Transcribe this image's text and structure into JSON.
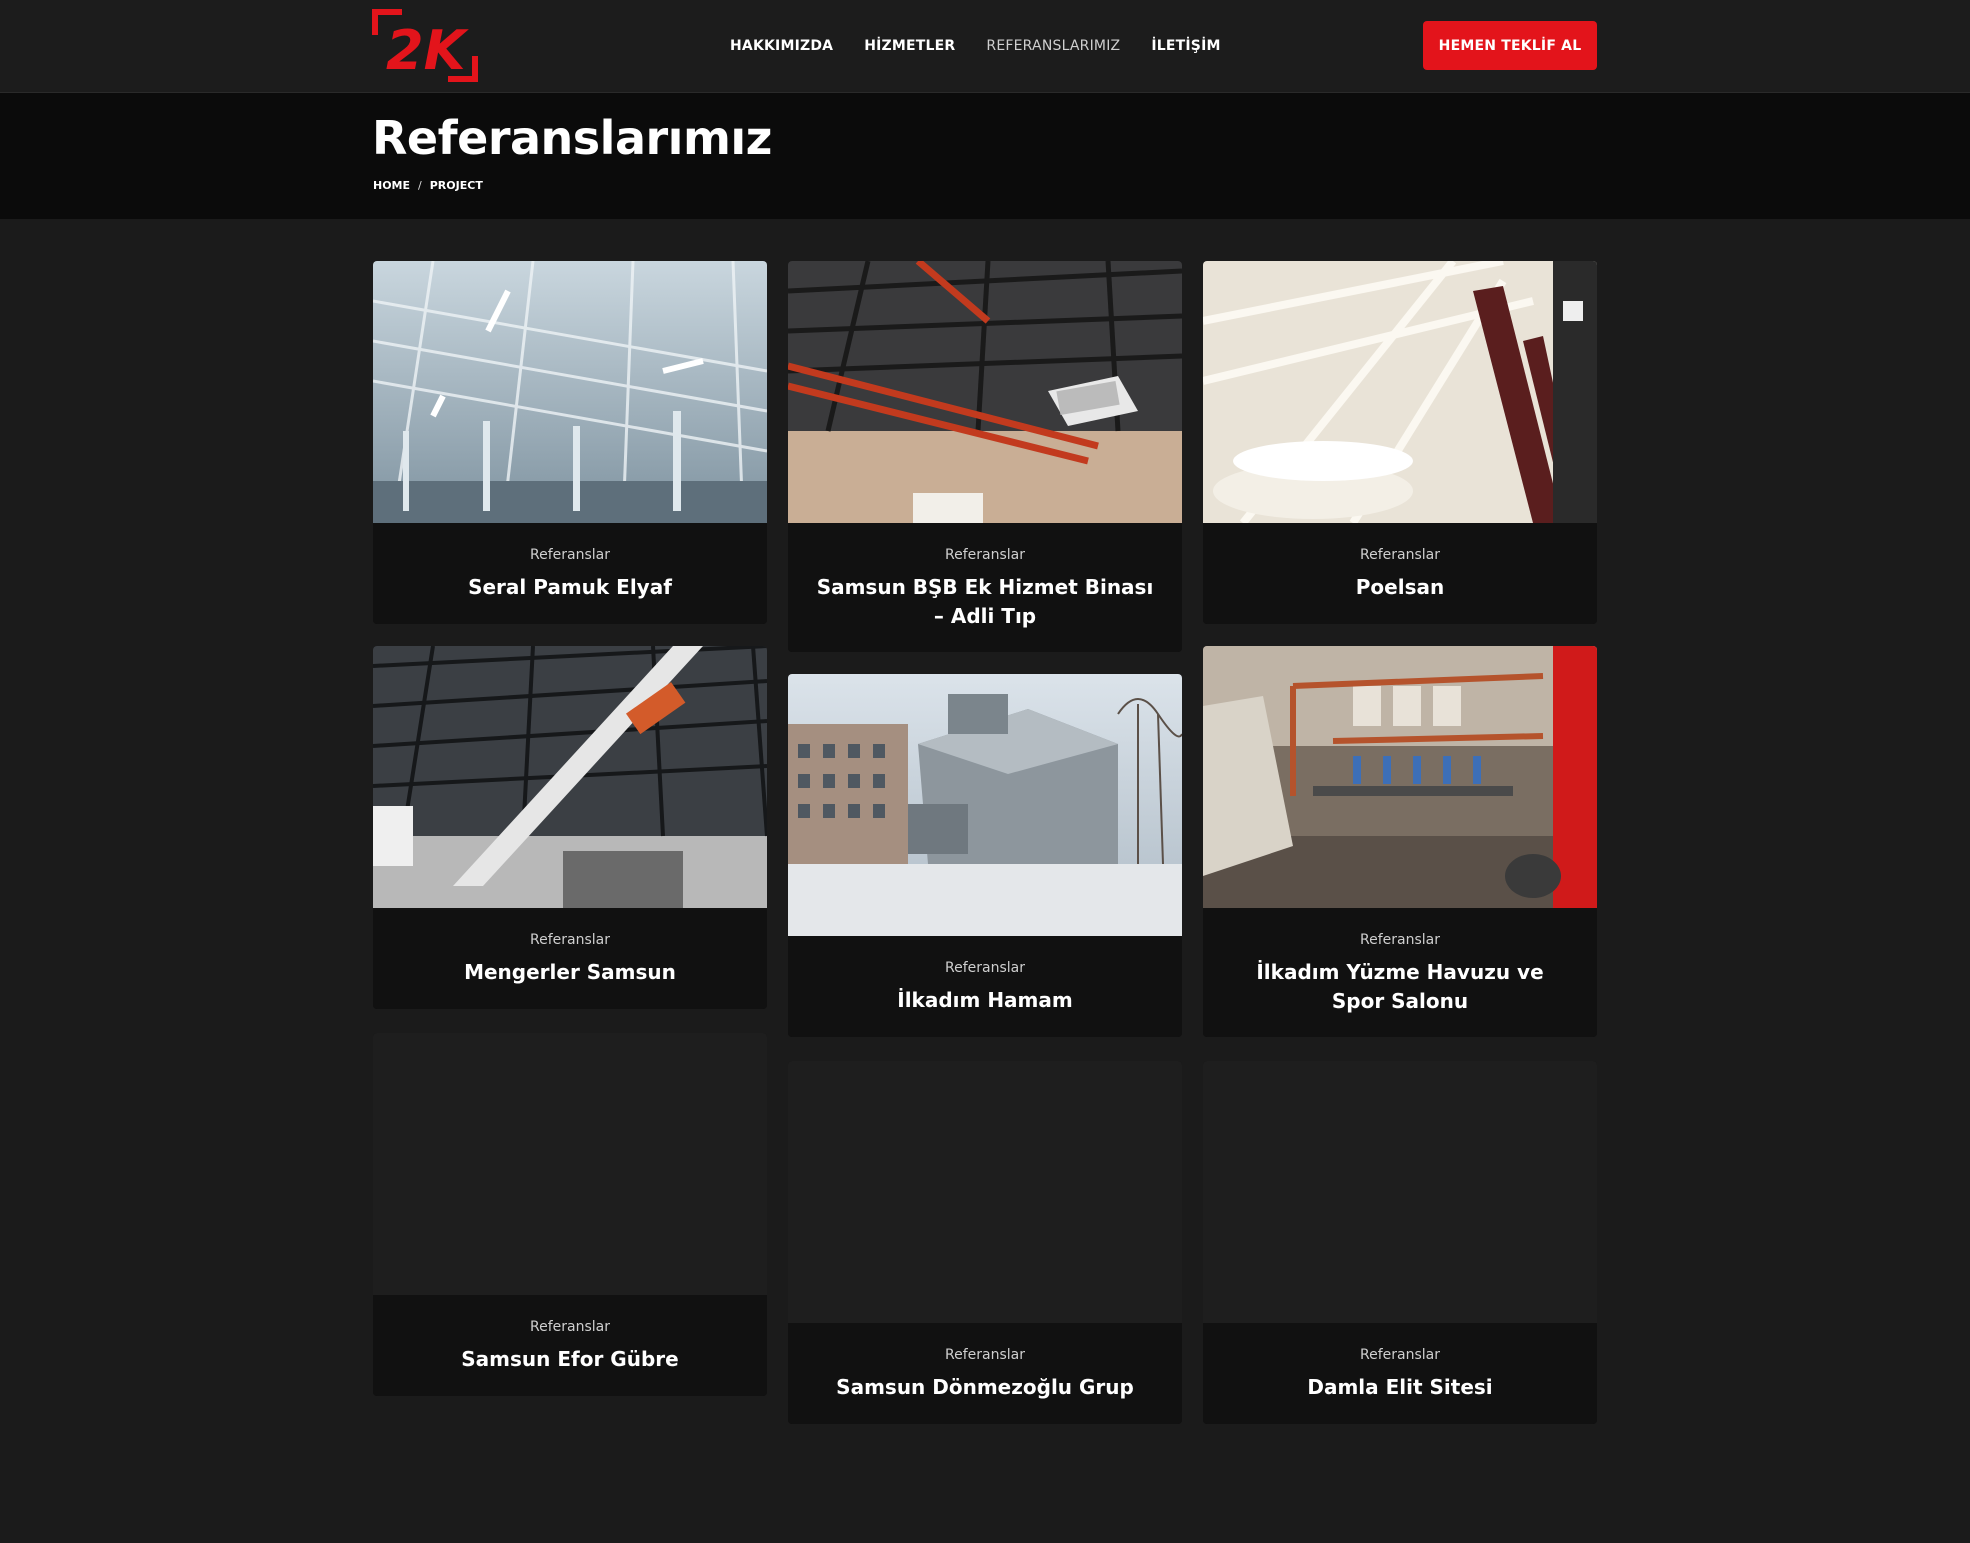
{
  "header": {
    "logo_text": "2K",
    "nav": [
      {
        "label": "HAKKIMIZDA"
      },
      {
        "label": "HİZMETLER"
      },
      {
        "label": "REFERANSLARIMIZ"
      },
      {
        "label": "İLETİŞİM"
      }
    ],
    "cta_label": "HEMEN TEKLİF AL"
  },
  "banner": {
    "title": "Referanslarımız",
    "breadcrumb": [
      "HOME",
      "PROJECT"
    ],
    "separator": "/"
  },
  "projects": [
    {
      "category": "Referanslar",
      "title": "Seral Pamuk Elyaf"
    },
    {
      "category": "Referanslar",
      "title": "Samsun BŞB Ek Hizmet Binası – Adli Tıp"
    },
    {
      "category": "Referanslar",
      "title": "Poelsan"
    },
    {
      "category": "Referanslar",
      "title": "Mengerler Samsun"
    },
    {
      "category": "Referanslar",
      "title": "İlkadım Hamam"
    },
    {
      "category": "Referanslar",
      "title": "İlkadım Yüzme Havuzu ve Spor Salonu"
    },
    {
      "category": "Referanslar",
      "title": "Samsun Efor Gübre"
    },
    {
      "category": "Referanslar",
      "title": "Samsun Dönmezoğlu Grup"
    },
    {
      "category": "Referanslar",
      "title": "Damla Elit Sitesi"
    }
  ],
  "colors": {
    "accent": "#e3141b",
    "background": "#1b1b1b",
    "card": "#111111"
  }
}
